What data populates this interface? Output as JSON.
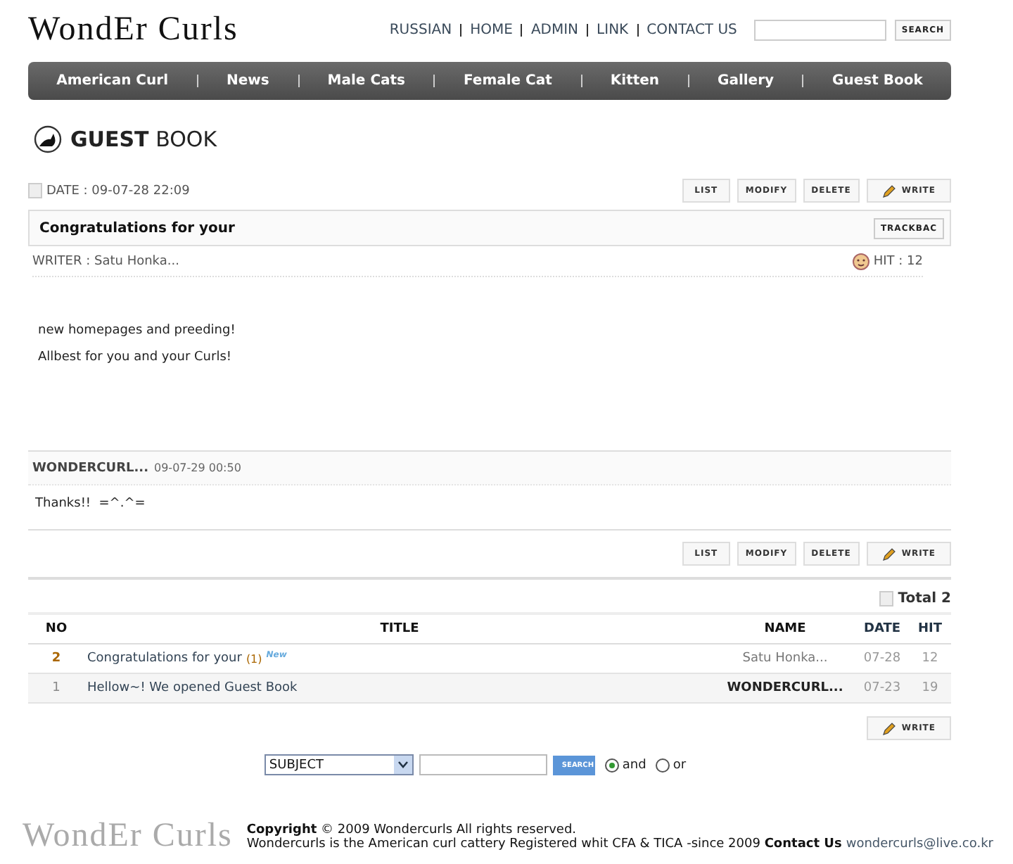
{
  "logo": "WondEr Curls",
  "top_links": [
    "RUSSIAN",
    "HOME",
    "ADMIN",
    "LINK",
    "CONTACT US"
  ],
  "top_search": {
    "button": "SEARCH"
  },
  "nav": [
    {
      "label": "American Curl"
    },
    {
      "label": "News"
    },
    {
      "label": "Male Cats"
    },
    {
      "label": "Female Cat"
    },
    {
      "label": "Kitten"
    },
    {
      "label": "Gallery"
    },
    {
      "label": "Guest Book"
    }
  ],
  "page_title": {
    "bold": "GUEST",
    "rest": "BOOK"
  },
  "post": {
    "date": "DATE : 09-07-28 22:09",
    "subject": "Congratulations for your",
    "trackback": "TRACKBAC",
    "writer": "WRITER : Satu Honka...",
    "hit": "HIT : 12",
    "body": [
      "new homepages and preeding!",
      "Allbest for you and your Curls!"
    ]
  },
  "actions_top": [
    {
      "label": "LIST",
      "kind": "plain"
    },
    {
      "label": "MODIFY",
      "kind": "plain"
    },
    {
      "label": "DELETE",
      "kind": "plain"
    },
    {
      "label": "WRITE",
      "kind": "write"
    }
  ],
  "comment": {
    "author": "WONDERCURL...",
    "date": "09-07-29 00:50",
    "text": "Thanks!!  =^.^="
  },
  "actions_bottom": [
    {
      "label": "LIST",
      "kind": "plain"
    },
    {
      "label": "MODIFY",
      "kind": "plain"
    },
    {
      "label": "DELETE",
      "kind": "plain"
    },
    {
      "label": "WRITE",
      "kind": "write"
    }
  ],
  "total": "Total 2",
  "table": {
    "columns": [
      "NO",
      "TITLE",
      "NAME",
      "DATE",
      "HIT"
    ],
    "rows": [
      {
        "no": "2",
        "title": "Congratulations for your",
        "comments": "(1)",
        "badge": "New",
        "name": "Satu Honka...",
        "date": "07-28",
        "hit": "12",
        "highlighted": true,
        "admin": false
      },
      {
        "no": "1",
        "title": "Hellow~! We opened Guest Book",
        "name": "WONDERCURL...",
        "date": "07-23",
        "hit": "19",
        "highlighted": false,
        "admin": true
      }
    ]
  },
  "write_button": "WRITE",
  "search": {
    "field": "SUBJECT",
    "button": "SEARCH",
    "options": [
      {
        "label": "and",
        "selected": true
      },
      {
        "label": "or",
        "selected": false
      }
    ]
  },
  "footer": {
    "logo": "WondEr Curls",
    "line1": "**Copyright** © 2009 Wondercurls All rights reserved.",
    "line2": "Wondercurls is the American curl cattery Registered whit CFA & TICA -since 2009 **Contact Us**",
    "email": "wondercurls@live.co.kr"
  }
}
